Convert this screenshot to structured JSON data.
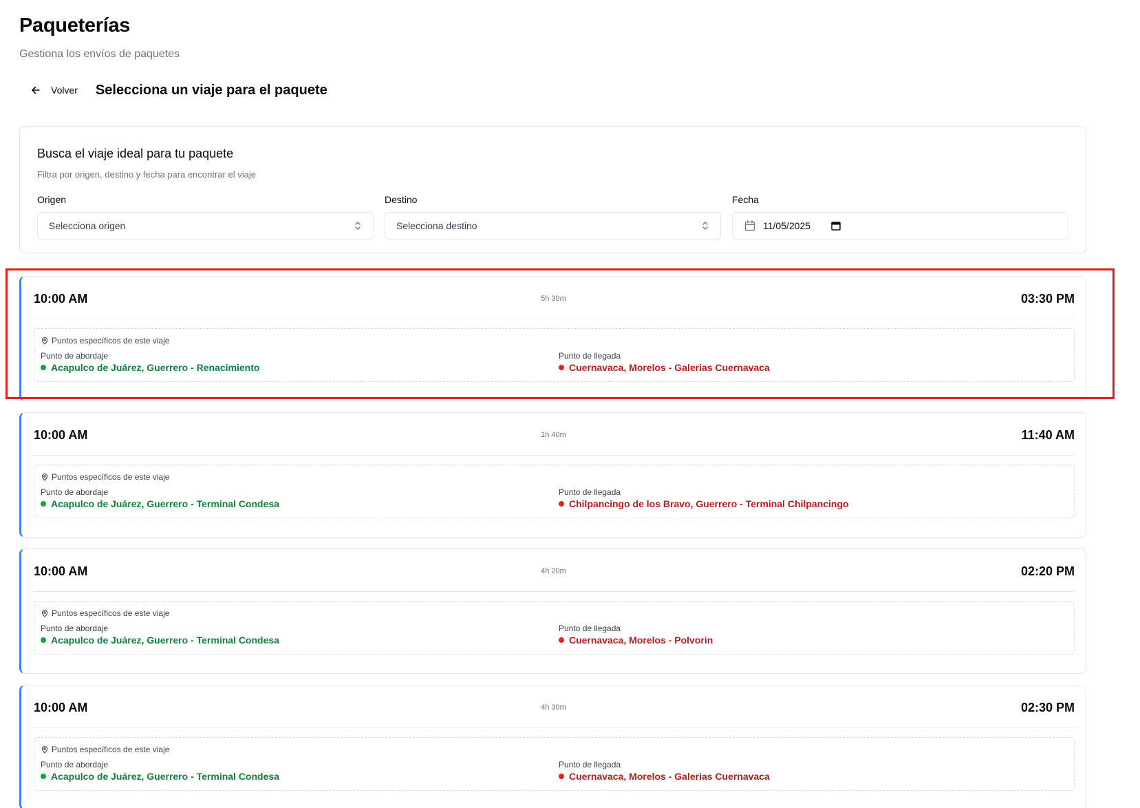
{
  "header": {
    "title": "Paqueterías",
    "subtitle": "Gestiona los envíos de paquetes"
  },
  "nav": {
    "back_label": "Volver",
    "section_title": "Selecciona un viaje para el paquete"
  },
  "filters": {
    "title": "Busca el viaje ideal para tu paquete",
    "description": "Filtra por origen, destino y fecha para encontrar el viaje",
    "origin": {
      "label": "Origen",
      "placeholder": "Selecciona origen"
    },
    "destination": {
      "label": "Destino",
      "placeholder": "Selecciona destino"
    },
    "date": {
      "label": "Fecha",
      "value": "11/05/2025"
    }
  },
  "trip_labels": {
    "points_title": "Puntos específicos de este viaje",
    "boarding_label": "Punto de abordaje",
    "arrival_label": "Punto de llegada"
  },
  "trips": [
    {
      "departure": "10:00 AM",
      "duration": "5h 30m",
      "arrival": "03:30 PM",
      "boarding_point": "Acapulco de Juárez, Guerrero - Renacimiento",
      "arrival_point": "Cuernavaca, Morelos - Galerias Cuernavaca"
    },
    {
      "departure": "10:00 AM",
      "duration": "1h 40m",
      "arrival": "11:40 AM",
      "boarding_point": "Acapulco de Juárez, Guerrero - Terminal Condesa",
      "arrival_point": "Chilpancingo de los Bravo, Guerrero - Terminal Chilpancingo"
    },
    {
      "departure": "10:00 AM",
      "duration": "4h 20m",
      "arrival": "02:20 PM",
      "boarding_point": "Acapulco de Juárez, Guerrero - Terminal Condesa",
      "arrival_point": "Cuernavaca, Morelos - Polvorin"
    },
    {
      "departure": "10:00 AM",
      "duration": "4h 30m",
      "arrival": "02:30 PM",
      "boarding_point": "Acapulco de Juárez, Guerrero - Terminal Condesa",
      "arrival_point": "Cuernavaca, Morelos - Galerias Cuernavaca"
    }
  ],
  "colors": {
    "accent_border": "#3b82f6",
    "boarding_green": "#15803d",
    "arrival_red": "#b91c1c",
    "highlight_red": "#e11d1d"
  },
  "icons": [
    "arrow-left-icon",
    "chevron-up-down-icon",
    "calendar-icon",
    "map-pin-icon"
  ]
}
